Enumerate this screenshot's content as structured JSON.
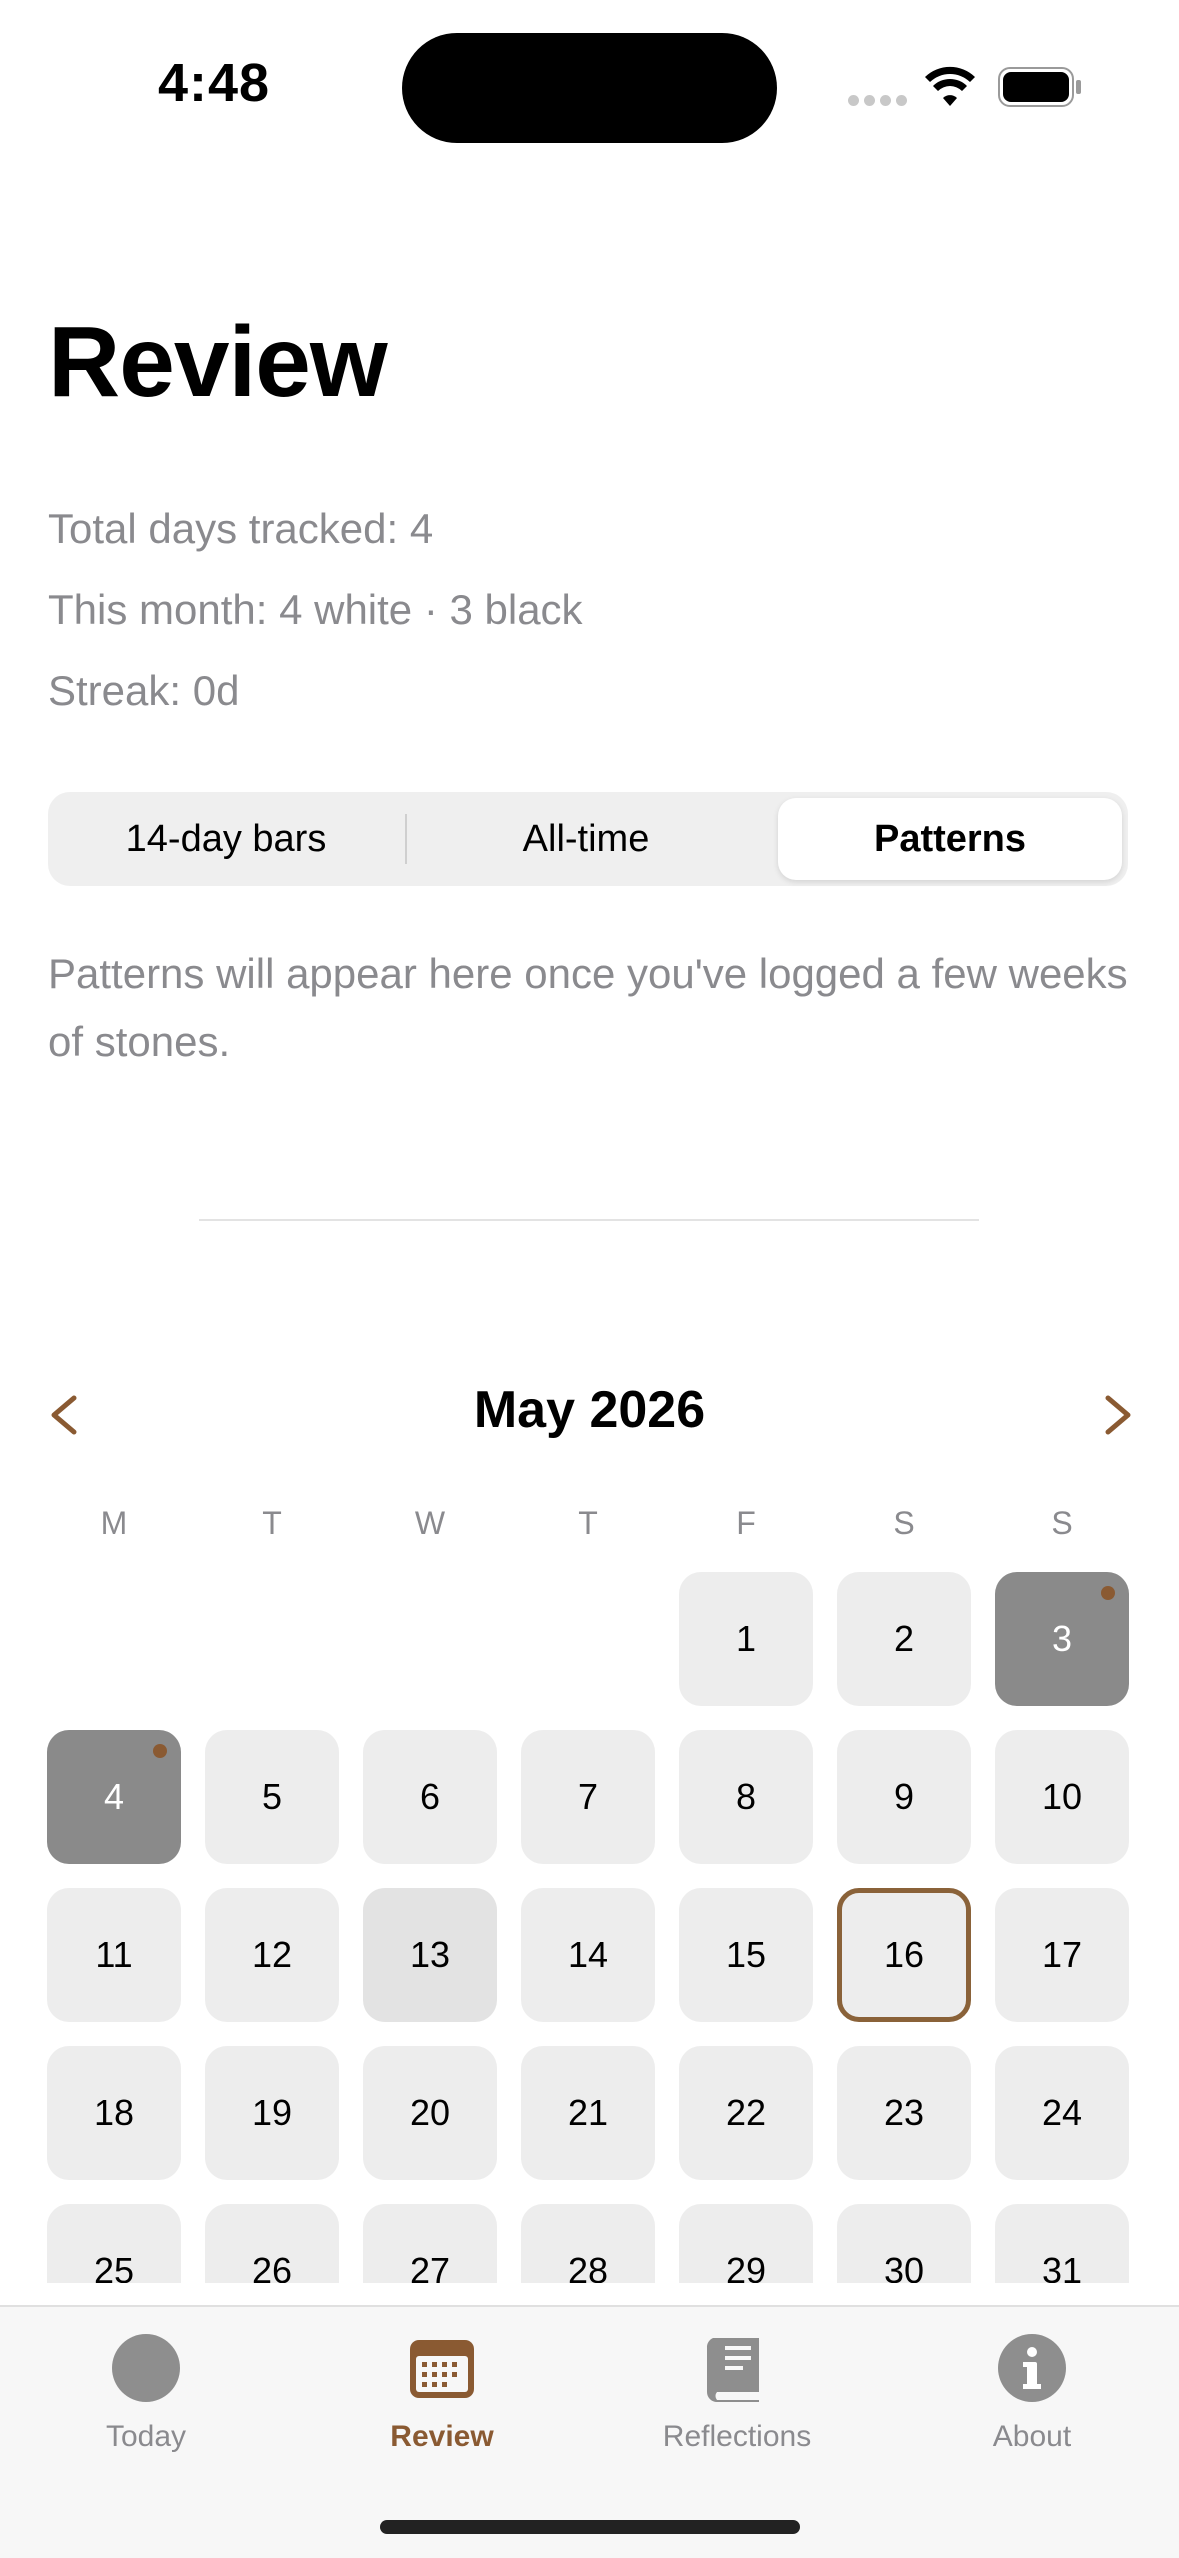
{
  "status_bar": {
    "time": "4:48"
  },
  "header": {
    "title": "Review"
  },
  "stats": {
    "total": "Total days tracked: 4",
    "month": "This month: 4 white · 3 black",
    "streak": "Streak: 0d"
  },
  "segments": [
    "14-day bars",
    "All-time",
    "Patterns"
  ],
  "selected_segment": "Patterns",
  "patterns_message": "Patterns will appear here once you've logged a few weeks of stones.",
  "calendar": {
    "month_label": "May 2026",
    "weekdays": [
      "M",
      "T",
      "W",
      "T",
      "F",
      "S",
      "S"
    ],
    "first_weekday_index": 4,
    "days": [
      "1",
      "2",
      "3",
      "4",
      "5",
      "6",
      "7",
      "8",
      "9",
      "10",
      "11",
      "12",
      "13",
      "14",
      "15",
      "16",
      "17",
      "18",
      "19",
      "20",
      "21",
      "22",
      "23",
      "24",
      "25",
      "26",
      "27",
      "28",
      "29",
      "30",
      "31"
    ],
    "dark_days": [
      "3",
      "4"
    ],
    "dot_days": [
      "3",
      "4"
    ],
    "highlight_days": [
      "13"
    ],
    "today": "16"
  },
  "tabs": [
    {
      "label": "Today",
      "icon": "circle-icon"
    },
    {
      "label": "Review",
      "icon": "calendar-icon"
    },
    {
      "label": "Reflections",
      "icon": "book-icon"
    },
    {
      "label": "About",
      "icon": "info-icon"
    }
  ],
  "active_tab": "Review",
  "colors": {
    "accent": "#8a5a32",
    "dark_stone": "#8a8a8a",
    "secondary_text": "#8a8a8e"
  }
}
